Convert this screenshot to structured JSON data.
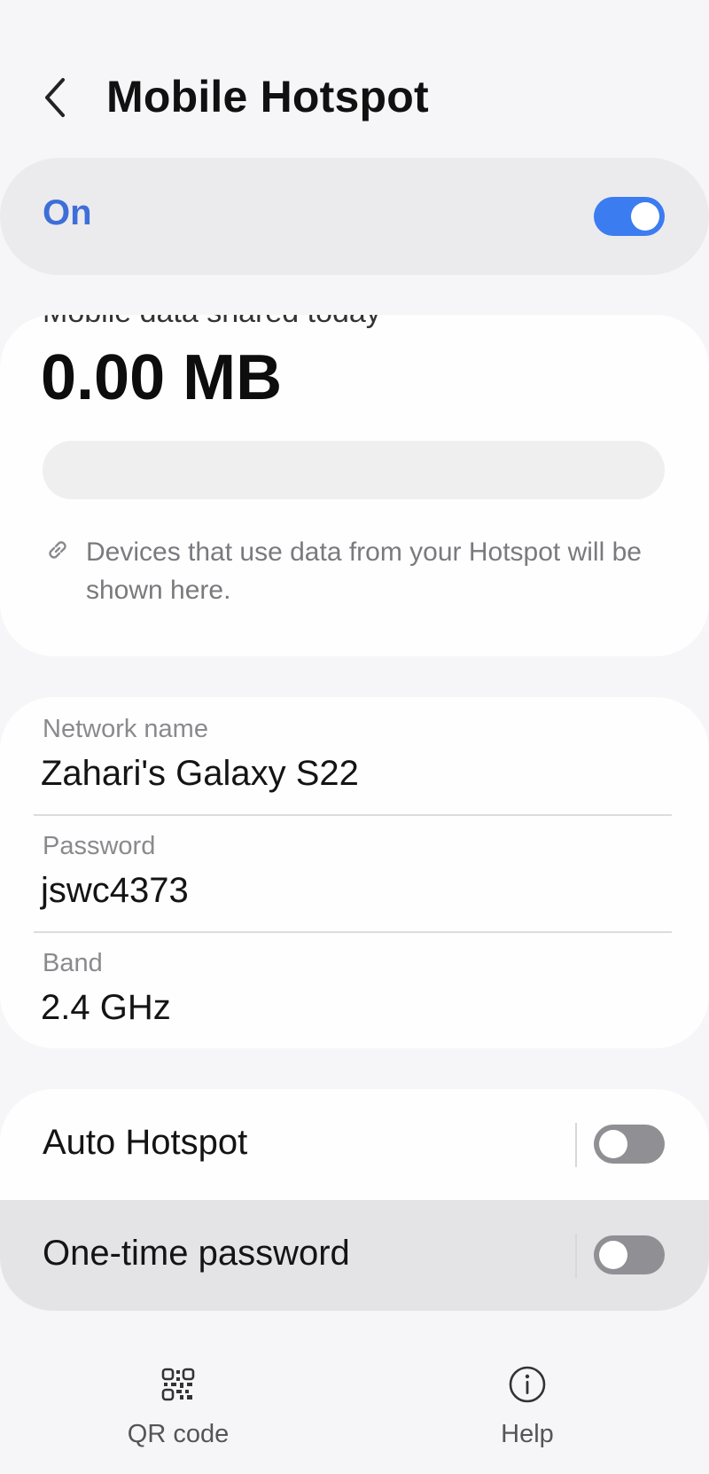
{
  "header": {
    "title": "Mobile Hotspot",
    "back_icon": "chevron-left-icon"
  },
  "master_switch": {
    "label": "On",
    "state": true,
    "accent": "#3b7cf1",
    "label_color": "#3e6fd8"
  },
  "usage": {
    "caption_partial": "Mobile data shared today",
    "amount": "0.00 MB",
    "usage_fraction": 0,
    "note_icon": "link-icon",
    "note": "Devices that use data from your Hotspot will be shown here."
  },
  "network": {
    "name_label": "Network name",
    "name_value": "Zahari's Galaxy S22",
    "password_label": "Password",
    "password_value": "jswc4373",
    "band_label": "Band",
    "band_value": "2.4 GHz"
  },
  "toggles": [
    {
      "label": "Auto Hotspot",
      "state": false
    },
    {
      "label": "One-time password",
      "state": false
    }
  ],
  "bottom_nav": [
    {
      "label": "QR code",
      "icon": "qr-code-icon"
    },
    {
      "label": "Help",
      "icon": "info-icon"
    }
  ]
}
